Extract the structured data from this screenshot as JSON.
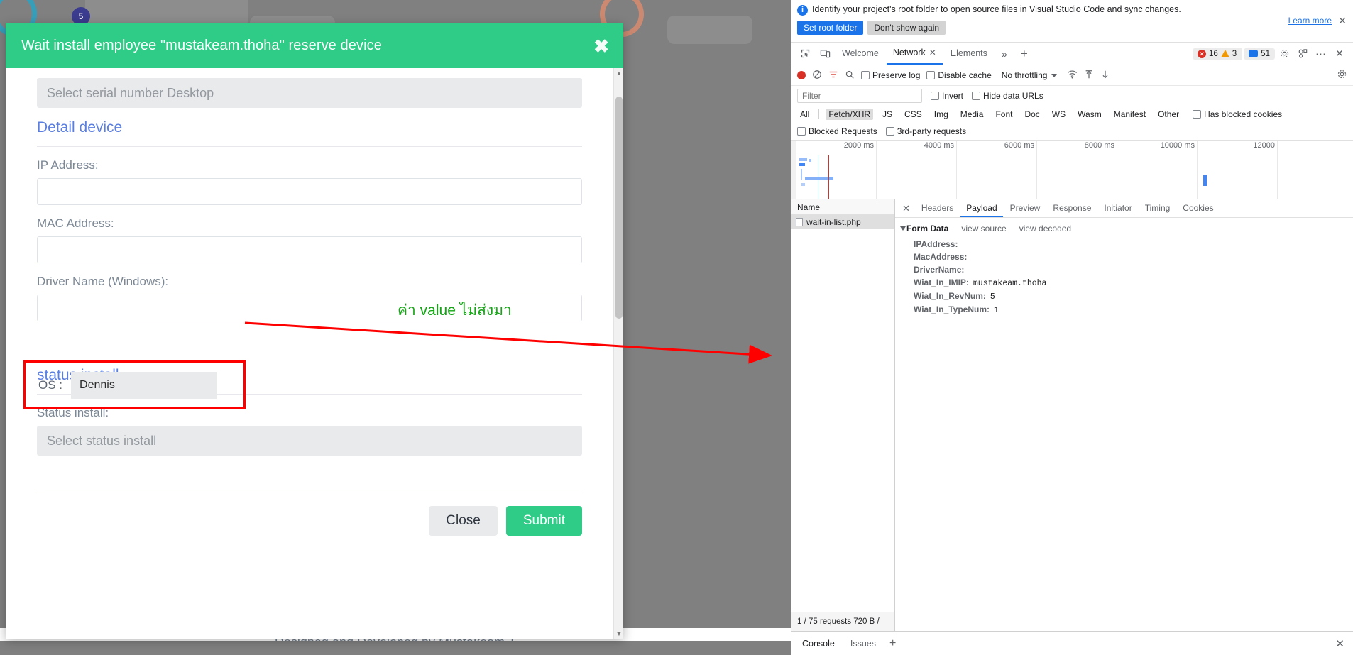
{
  "page": {
    "footer_text": "Designed and Developed by Mustakeam.T",
    "background_badge": "5"
  },
  "modal": {
    "title": "Wait install employee \"mustakeam.thoha\" reserve device",
    "close_icon": "close-icon",
    "serial_placeholder": "Select serial number Desktop",
    "section_detail": "Detail device",
    "fields": [
      {
        "label": "IP Address:",
        "value": ""
      },
      {
        "label": "MAC Address:",
        "value": ""
      },
      {
        "label": "Driver Name (Windows):",
        "value": ""
      }
    ],
    "os_label": "OS :",
    "os_value": "Dennis",
    "section_status": "status install",
    "status_label": "Status install:",
    "status_placeholder": "Select status install",
    "close_button": "Close",
    "submit_button": "Submit",
    "accent_green": "#2ecc87",
    "link_blue": "#5b7fe0"
  },
  "annotation": {
    "note": "ค่า value ไม่ส่งมา",
    "note_color": "#13a513",
    "box_color": "#ff0000"
  },
  "devtools": {
    "info_bar": {
      "icon": "info-icon",
      "text": "Identify your project's root folder to open source files in Visual Studio Code and sync changes.",
      "primary_button": "Set root folder",
      "secondary_button": "Don't show again",
      "learn_more": "Learn more",
      "close_icon": "close-icon"
    },
    "left_icons": [
      "inspect-element-icon",
      "device-toolbar-icon"
    ],
    "tabs": [
      {
        "label": "Welcome",
        "active": false,
        "closable": false
      },
      {
        "label": "Network",
        "active": true,
        "closable": true
      },
      {
        "label": "Elements",
        "active": false,
        "closable": false
      }
    ],
    "more_tabs_icon": "chevrons-right-icon",
    "add_tab_icon": "plus-icon",
    "counters": {
      "errors": "16",
      "warnings": "3",
      "messages": "51"
    },
    "right_icons": [
      "settings-gear-icon",
      "customize-devtools-icon",
      "more-options-icon",
      "close-devtools-icon"
    ],
    "network_toolbar": {
      "record_icon": "record-stop-icon",
      "clear_icon": "clear-network-icon",
      "filter_icon": "filter-icon",
      "search_icon": "search-icon",
      "preserve_log": "Preserve log",
      "disable_cache": "Disable cache",
      "throttling": "No throttling",
      "wifi_icon": "network-conditions-icon",
      "import_icon": "import-har-icon",
      "export_icon": "export-har-icon",
      "settings_icon": "network-settings-icon"
    },
    "filter_row": {
      "placeholder": "Filter",
      "invert": "Invert",
      "hide_data_urls": "Hide data URLs"
    },
    "resource_types": [
      "All",
      "Fetch/XHR",
      "JS",
      "CSS",
      "Img",
      "Media",
      "Font",
      "Doc",
      "WS",
      "Wasm",
      "Manifest",
      "Other"
    ],
    "selected_resource_type": "Fetch/XHR",
    "has_blocked_cookies": "Has blocked cookies",
    "blocked_requests": "Blocked Requests",
    "third_party_requests": "3rd-party requests",
    "overview": {
      "ticks": [
        "2000 ms",
        "4000 ms",
        "6000 ms",
        "8000 ms",
        "10000 ms",
        "12000"
      ]
    },
    "list": {
      "header": "Name",
      "rows": [
        {
          "name": "wait-in-list.php",
          "icon": "document-icon",
          "selected": true
        }
      ]
    },
    "detail_tabs": [
      {
        "label": "Headers",
        "active": false
      },
      {
        "label": "Payload",
        "active": true
      },
      {
        "label": "Preview",
        "active": false
      },
      {
        "label": "Response",
        "active": false
      },
      {
        "label": "Initiator",
        "active": false
      },
      {
        "label": "Timing",
        "active": false
      },
      {
        "label": "Cookies",
        "active": false
      }
    ],
    "payload": {
      "section_title": "Form Data",
      "view_source": "view source",
      "view_decoded": "view decoded",
      "rows": [
        {
          "key": "IPAddress:",
          "value": ""
        },
        {
          "key": "MacAddress:",
          "value": ""
        },
        {
          "key": "DriverName:",
          "value": ""
        },
        {
          "key": "Wiat_In_IMIP:",
          "value": "mustakeam.thoha"
        },
        {
          "key": "Wiat_In_RevNum:",
          "value": "5"
        },
        {
          "key": "Wiat_In_TypeNum:",
          "value": "1"
        }
      ]
    },
    "status_bar": "1 / 75 requests  720 B / ",
    "drawer": {
      "tabs": [
        {
          "label": "Console",
          "active": true
        },
        {
          "label": "Issues",
          "active": false
        }
      ],
      "add_icon": "plus-icon",
      "close_icon": "close-icon"
    }
  }
}
